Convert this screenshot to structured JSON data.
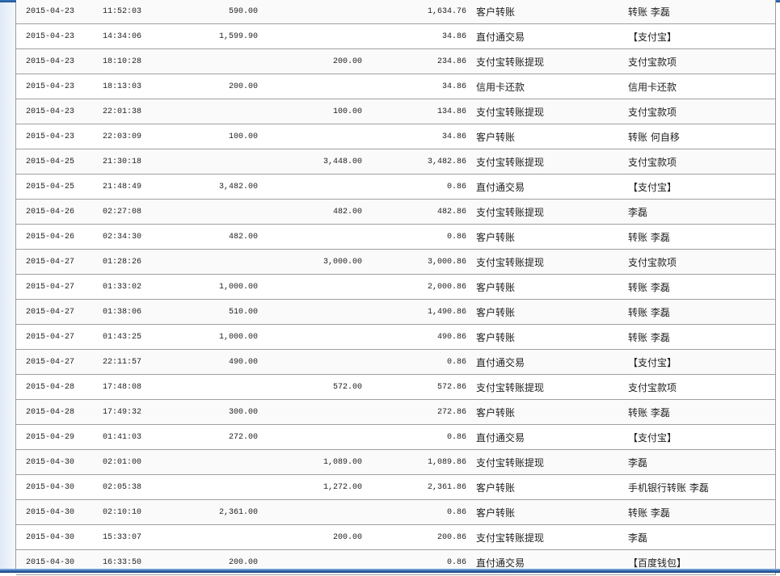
{
  "rows": [
    [
      "2015-04-23",
      "11:52:03",
      "590.00",
      "",
      "1,634.76",
      "客户转账",
      "转账 李磊"
    ],
    [
      "2015-04-23",
      "14:34:06",
      "1,599.90",
      "",
      "34.86",
      "直付通交易",
      "【支付宝】"
    ],
    [
      "2015-04-23",
      "18:10:28",
      "",
      "200.00",
      "234.86",
      "支付宝转账提现",
      "支付宝款项"
    ],
    [
      "2015-04-23",
      "18:13:03",
      "200.00",
      "",
      "34.86",
      "信用卡还款",
      "信用卡还款"
    ],
    [
      "2015-04-23",
      "22:01:38",
      "",
      "100.00",
      "134.86",
      "支付宝转账提现",
      "支付宝款项"
    ],
    [
      "2015-04-23",
      "22:03:09",
      "100.00",
      "",
      "34.86",
      "客户转账",
      "转账 何自移"
    ],
    [
      "2015-04-25",
      "21:30:18",
      "",
      "3,448.00",
      "3,482.86",
      "支付宝转账提现",
      "支付宝款项"
    ],
    [
      "2015-04-25",
      "21:48:49",
      "3,482.00",
      "",
      "0.86",
      "直付通交易",
      "【支付宝】"
    ],
    [
      "2015-04-26",
      "02:27:08",
      "",
      "482.00",
      "482.86",
      "支付宝转账提现",
      "李磊"
    ],
    [
      "2015-04-26",
      "02:34:30",
      "482.00",
      "",
      "0.86",
      "客户转账",
      "转账 李磊"
    ],
    [
      "2015-04-27",
      "01:28:26",
      "",
      "3,000.00",
      "3,000.86",
      "支付宝转账提现",
      "支付宝款项"
    ],
    [
      "2015-04-27",
      "01:33:02",
      "1,000.00",
      "",
      "2,000.86",
      "客户转账",
      "转账 李磊"
    ],
    [
      "2015-04-27",
      "01:38:06",
      "510.00",
      "",
      "1,490.86",
      "客户转账",
      "转账 李磊"
    ],
    [
      "2015-04-27",
      "01:43:25",
      "1,000.00",
      "",
      "490.86",
      "客户转账",
      "转账 李磊"
    ],
    [
      "2015-04-27",
      "22:11:57",
      "490.00",
      "",
      "0.86",
      "直付通交易",
      "【支付宝】"
    ],
    [
      "2015-04-28",
      "17:48:08",
      "",
      "572.00",
      "572.86",
      "支付宝转账提现",
      "支付宝款项"
    ],
    [
      "2015-04-28",
      "17:49:32",
      "300.00",
      "",
      "272.86",
      "客户转账",
      "转账 李磊"
    ],
    [
      "2015-04-29",
      "01:41:03",
      "272.00",
      "",
      "0.86",
      "直付通交易",
      "【支付宝】"
    ],
    [
      "2015-04-30",
      "02:01:00",
      "",
      "1,089.00",
      "1,089.86",
      "支付宝转账提现",
      "李磊"
    ],
    [
      "2015-04-30",
      "02:05:38",
      "",
      "1,272.00",
      "2,361.86",
      "客户转账",
      "手机银行转账 李磊"
    ],
    [
      "2015-04-30",
      "02:10:10",
      "2,361.00",
      "",
      "0.86",
      "客户转账",
      "转账 李磊"
    ],
    [
      "2015-04-30",
      "15:33:07",
      "",
      "200.00",
      "200.86",
      "支付宝转账提现",
      "李磊"
    ],
    [
      "2015-04-30",
      "16:33:50",
      "200.00",
      "",
      "0.86",
      "直付通交易",
      "【百度钱包】"
    ]
  ]
}
